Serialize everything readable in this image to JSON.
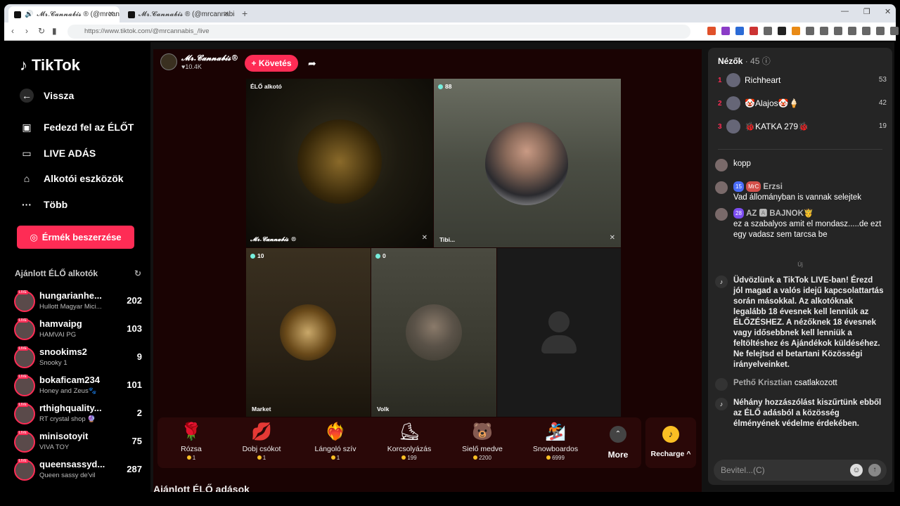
{
  "browser": {
    "tabs": [
      {
        "title": "𝓜𝓻.𝓒𝓪𝓷𝓷𝓪𝓫𝓲𝓼 ® (@mrcan..."
      },
      {
        "title": "𝓜𝓻.𝓒𝓪𝓷𝓷𝓪𝓫𝓲𝓼 ® (@mrcannabis_)"
      }
    ],
    "new_tab": "+",
    "url": "https://www.tiktok.com/@mrcannabis_/live"
  },
  "sidebar": {
    "brand": "TikTok",
    "back": "Vissza",
    "nav": [
      {
        "label": "Fedezd fel az ÉLŐT"
      },
      {
        "label": "LIVE ADÁS"
      },
      {
        "label": "Alkotói eszközök"
      },
      {
        "label": "Több"
      }
    ],
    "coins_button": "Érmék beszerzése",
    "recommended_title": "Ajánlott ÉLŐ alkotók",
    "creators": [
      {
        "name": "hungarianhe...",
        "sub": "Hullott Magyar Mici...",
        "count": "202"
      },
      {
        "name": "hamvaipg",
        "sub": "HAMVAI PG",
        "count": "103"
      },
      {
        "name": "snookims2",
        "sub": "Snooky 1",
        "count": "9"
      },
      {
        "name": "bokaficam234",
        "sub": "Honey and Zeus🐾",
        "count": "101"
      },
      {
        "name": "rthighquality...",
        "sub": "RT crystal shop 🔮",
        "count": "2"
      },
      {
        "name": "minisotoyit",
        "sub": "VIVA TOY",
        "count": "75"
      },
      {
        "name": "queensassyd...",
        "sub": "Queen sassy de'vil",
        "count": "287"
      }
    ]
  },
  "stream": {
    "host_name": "𝓜𝓻.𝓒𝓪𝓷𝓷𝓪𝓫𝓲𝓼®",
    "host_likes": "♥10.4K",
    "follow_button": "+ Követés",
    "tiles": [
      {
        "label": "𝓜𝓻.𝓒𝓪𝓷𝓷𝓪𝓫𝓲𝓼 ®",
        "badge": "ÉLŐ alkotó"
      },
      {
        "label": "Tibi...",
        "badge": "88"
      },
      {
        "label": "Market",
        "badge": "10"
      },
      {
        "label": "Volk",
        "badge": "0"
      }
    ],
    "gifts": [
      {
        "name": "Rózsa",
        "price": "1",
        "icon": "🌹"
      },
      {
        "name": "Dobj csókot",
        "price": "1",
        "icon": "💋"
      },
      {
        "name": "Lángoló szív",
        "price": "1",
        "icon": "❤️‍🔥"
      },
      {
        "name": "Korcsolyázás",
        "price": "199",
        "icon": "⛸"
      },
      {
        "name": "Sielő medve",
        "price": "2200",
        "icon": "🐻"
      },
      {
        "name": "Snowboardos",
        "price": "6999",
        "icon": "🏂"
      }
    ],
    "more": "More",
    "recharge": "Recharge ^",
    "more_live_title": "Ajánlott ÉLŐ adások"
  },
  "chat": {
    "viewers_title": "Nézők",
    "viewers_count": "· 45",
    "top_viewers": [
      {
        "rank": "1",
        "name": "Richheart",
        "score": "53"
      },
      {
        "rank": "2",
        "name": "🤡Alajos🤡🍦",
        "score": "42"
      },
      {
        "rank": "3",
        "name": "🐞KATKA 279🐞",
        "score": "19"
      }
    ],
    "messages": [
      {
        "user": "",
        "text": "kopp"
      },
      {
        "user": "Erzsi",
        "tag": "15",
        "tag2": "MrC",
        "text": "Vad állományban is vannak selejtek"
      },
      {
        "user": "AZ 🅰 BAJNOK🤴",
        "tag": "28",
        "text": "ez a szabalyos amit el mondasz.....de ezt egy vadasz sem tarcsa be"
      }
    ],
    "new_marker": "Új",
    "system_welcome": "Üdvözlünk a TikTok LIVE-ban! Érezd jól magad a valós idejű kapcsolattartás során másokkal. Az alkotóknak legalább 18 évesnek kell lenniük az ÉLŐZÉSHEZ. A nézőknek 18 évesnek vagy idősebbnek kell lenniük a feltöltéshez és Ajándékok küldéséhez. Ne felejtsd el betartani Közösségi irányelveinket.",
    "joined_user": "Pethő Krisztian",
    "joined_text": "csatlakozott",
    "system_filter": "Néhány hozzászólást kiszűrtünk ebből az ÉLŐ adásból a közösség élményének védelme érdekében.",
    "input_placeholder": "Bevitel...(C)"
  }
}
